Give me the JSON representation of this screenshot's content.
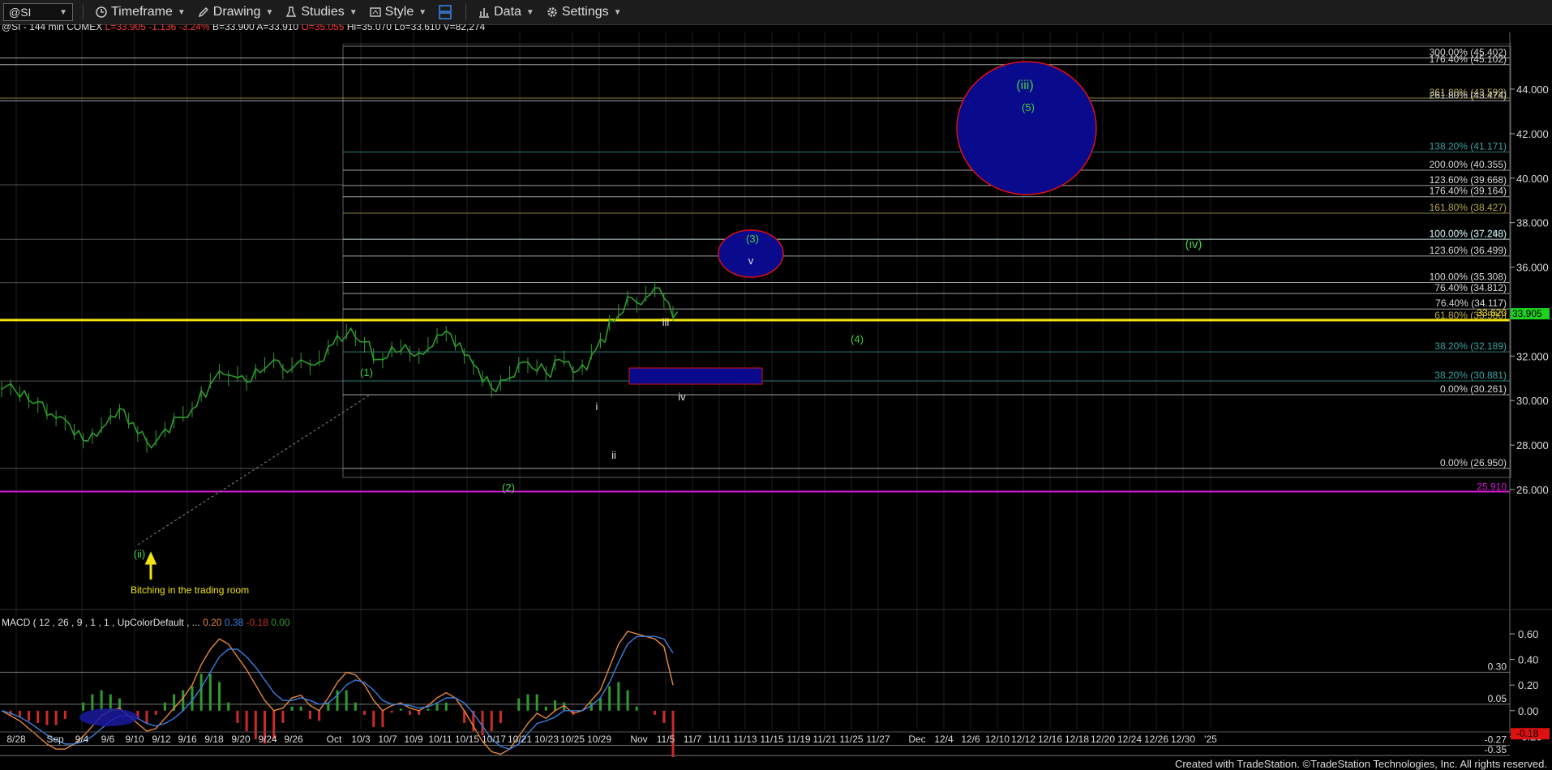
{
  "toolbar": {
    "symbol": "@SI",
    "timeframe": "Timeframe",
    "drawing": "Drawing",
    "studies": "Studies",
    "style": "Style",
    "data": "Data",
    "settings": "Settings"
  },
  "header": {
    "symbol_info": "@SI - 144 min  COMEX",
    "last": "L=33.905",
    "change": "-1.136",
    "pct": "-3.24%",
    "bid": "B=33.900",
    "ask": "A=33.910",
    "open": "O=35.055",
    "high": "Hi=35.070",
    "low": "Lo=33.610",
    "volume": "V=82,274"
  },
  "footer": "Created with TradeStation. ©TradeStation Technologies, Inc. All rights reserved.",
  "colors": {
    "up": "#2f9b2f",
    "down": "#cf2a2a",
    "fib_white": "#d8d8d8",
    "fib_teal": "#3aa3a3",
    "fib_olive": "#b5a84a",
    "yellow": "#f2e30c",
    "magenta": "#d61ad6",
    "wave_green": "#3fd53f",
    "navy": "#0a0a8c",
    "macd_blue": "#3b7de0",
    "macd_orange": "#e8883a"
  },
  "chart_data": {
    "type": "line",
    "title": "@SI - 144 min COMEX",
    "price_axis": {
      "ticks": [
        44,
        42,
        40,
        38,
        36,
        32,
        30,
        28,
        26
      ],
      "tick_labels": [
        "44.000",
        "42.000",
        "40.000",
        "38.000",
        "36.000",
        "32.000",
        "30.000",
        "28.000",
        "26.000"
      ],
      "ylim": [
        25.3,
        45.5
      ]
    },
    "time_axis": {
      "labels": [
        "8/28",
        "Sep",
        "9/4",
        "9/6",
        "9/10",
        "9/12",
        "9/16",
        "9/18",
        "9/20",
        "9/24",
        "9/26",
        "Oct",
        "10/3",
        "10/7",
        "10/9",
        "10/11",
        "10/15",
        "10/17",
        "10/21",
        "10/23",
        "10/25",
        "10/29",
        "Nov",
        "11/5",
        "11/7",
        "11/11",
        "11/13",
        "11/15",
        "11/19",
        "11/21",
        "11/25",
        "11/27",
        "Dec",
        "12/4",
        "12/6",
        "12/10",
        "12/12",
        "12/16",
        "12/18",
        "12/20",
        "12/24",
        "12/26",
        "12/30",
        "'25"
      ],
      "note": "bars labeled in calendar dates"
    },
    "series": [
      {
        "values": [
          30.5,
          30.6,
          30.3,
          30.0,
          29.8,
          29.5,
          29.2,
          29.0,
          28.6,
          28.2,
          28.4,
          28.9,
          29.3,
          29.5,
          29.1,
          28.5,
          28.0,
          28.3,
          28.7,
          29.1,
          29.4,
          29.6,
          30.3,
          30.9,
          31.3,
          31.0,
          31.2,
          30.8,
          31.3,
          31.6,
          31.8,
          31.3,
          31.6,
          31.8,
          31.5,
          31.9,
          32.4,
          32.8,
          33.1,
          32.8,
          32.5,
          32.0,
          31.8,
          32.3,
          32.4,
          32.1,
          32.0,
          32.5,
          32.9,
          33.0,
          32.6,
          32.0,
          31.5,
          31.0,
          30.5,
          30.8,
          31.2,
          31.6,
          31.6,
          31.5,
          31.2,
          31.7,
          31.9,
          31.2,
          31.5,
          32.2,
          32.7,
          33.5,
          34.0,
          34.6,
          34.3,
          34.8,
          35.0,
          34.5,
          33.9
        ]
      }
    ],
    "fib_levels": [
      {
        "label": "300.00% (45.402)",
        "value": 45.402,
        "color": "#d8d8d8"
      },
      {
        "label": "176.40% (45.102)",
        "value": 45.102,
        "color": "#d8d8d8"
      },
      {
        "label": "261.80% (43.599)",
        "value": 43.599,
        "color": "#b5a84a"
      },
      {
        "label": "261.80% (43.474)",
        "value": 43.474,
        "color": "#d8d8d8"
      },
      {
        "label": "138.20% (41.171)",
        "value": 41.171,
        "color": "#3aa3a3"
      },
      {
        "label": "200.00% (40.355)",
        "value": 40.355,
        "color": "#d8d8d8"
      },
      {
        "label": "123.60% (39.668)",
        "value": 39.668,
        "color": "#d8d8d8"
      },
      {
        "label": "176.40% (39.164)",
        "value": 39.164,
        "color": "#d8d8d8"
      },
      {
        "label": "161.80% (38.427)",
        "value": 38.427,
        "color": "#b5a84a"
      },
      {
        "label": "100.00% (37.260)",
        "value": 37.26,
        "color": "#3aa3a3"
      },
      {
        "label": "100.00% (37.248)",
        "value": 37.248,
        "color": "#d8d8d8"
      },
      {
        "label": "123.60% (36.499)",
        "value": 36.499,
        "color": "#d8d8d8"
      },
      {
        "label": "100.00% (35.308)",
        "value": 35.308,
        "color": "#d8d8d8"
      },
      {
        "label": "76.40% (34.812)",
        "value": 34.812,
        "color": "#d8d8d8"
      },
      {
        "label": "76.40% (34.117)",
        "value": 34.117,
        "color": "#d8d8d8"
      },
      {
        "label": "61.80% (33.580)",
        "value": 33.58,
        "color": "#b5a84a"
      },
      {
        "label": "38.20% (32.189)",
        "value": 32.189,
        "color": "#3aa3a3"
      },
      {
        "label": "38.20% (30.881)",
        "value": 30.881,
        "color": "#3aa3a3"
      },
      {
        "label": "0.00% (30.261)",
        "value": 30.261,
        "color": "#d8d8d8"
      },
      {
        "label": "0.00% (26.950)",
        "value": 26.95,
        "color": "#d8d8d8"
      }
    ],
    "marked_prices": [
      {
        "label": "33.620",
        "value": 33.62,
        "color": "#f2e30c"
      },
      {
        "label": "33.905",
        "value": 33.905,
        "color": "#1fd11f"
      },
      {
        "label": "25.910",
        "value": 25.91,
        "color": "#d61ad6"
      }
    ],
    "wave_labels": [
      {
        "text": "(1)",
        "color": "#3fd53f"
      },
      {
        "text": "(2)",
        "color": "#3fd53f"
      },
      {
        "text": "(3)",
        "color": "#3fd53f"
      },
      {
        "text": "(4)",
        "color": "#3fd53f"
      },
      {
        "text": "(5)",
        "color": "#3fd53f"
      },
      {
        "text": "(ii)",
        "color": "#3fd53f"
      },
      {
        "text": "(iii)",
        "color": "#3fd53f"
      },
      {
        "text": "(iv)",
        "color": "#3fd53f"
      },
      {
        "text": "i",
        "color": "#e0e0e0"
      },
      {
        "text": "ii",
        "color": "#e0e0e0"
      },
      {
        "text": "iii",
        "color": "#e0e0e0"
      },
      {
        "text": "iv",
        "color": "#e0e0e0"
      },
      {
        "text": "v",
        "color": "#e0e0e0"
      }
    ],
    "annotation": "Bitching in the trading room",
    "macd": {
      "label": "MACD ( 12 , 26 , 9 , 1 , 1 , UpColorDefault , ...",
      "readouts": [
        "0.20",
        "0.38",
        "-0.18",
        "0.00"
      ],
      "axis_ticks": [
        0.6,
        0.4,
        0.2,
        0.0,
        -0.2
      ],
      "axis_labels": [
        "0.60",
        "0.40",
        "0.20",
        "0.00",
        "-0.20"
      ],
      "levels": [
        {
          "label": "0.30",
          "value": 0.3
        },
        {
          "label": "0.05",
          "value": 0.05
        },
        {
          "label": "-0.27",
          "value": -0.27
        },
        {
          "label": "-0.35",
          "value": -0.35
        }
      ],
      "current": "-0.18",
      "ylim": [
        -0.4,
        0.7
      ],
      "macd": [
        0.0,
        -0.04,
        -0.08,
        -0.14,
        -0.2,
        -0.26,
        -0.3,
        -0.3,
        -0.26,
        -0.2,
        -0.12,
        -0.04,
        0.0,
        0.02,
        -0.04,
        -0.1,
        -0.16,
        -0.14,
        -0.06,
        0.02,
        0.1,
        0.2,
        0.36,
        0.48,
        0.56,
        0.52,
        0.42,
        0.32,
        0.2,
        0.08,
        0.0,
        0.02,
        0.1,
        0.12,
        0.04,
        0.0,
        0.1,
        0.22,
        0.3,
        0.28,
        0.2,
        0.08,
        0.0,
        0.04,
        0.06,
        0.02,
        0.0,
        0.04,
        0.1,
        0.14,
        0.1,
        0.0,
        -0.12,
        -0.24,
        -0.32,
        -0.34,
        -0.3,
        -0.2,
        -0.1,
        -0.02,
        -0.06,
        0.0,
        0.04,
        -0.02,
        0.0,
        0.08,
        0.16,
        0.34,
        0.52,
        0.62,
        0.6,
        0.58,
        0.56,
        0.5,
        0.2
      ],
      "signal": [
        0.0,
        -0.02,
        -0.05,
        -0.09,
        -0.14,
        -0.19,
        -0.23,
        -0.26,
        -0.26,
        -0.24,
        -0.2,
        -0.14,
        -0.08,
        -0.04,
        -0.04,
        -0.06,
        -0.1,
        -0.12,
        -0.1,
        -0.06,
        0.0,
        0.08,
        0.18,
        0.3,
        0.42,
        0.48,
        0.48,
        0.42,
        0.34,
        0.24,
        0.14,
        0.08,
        0.08,
        0.1,
        0.08,
        0.05,
        0.06,
        0.12,
        0.2,
        0.24,
        0.22,
        0.16,
        0.08,
        0.05,
        0.05,
        0.04,
        0.02,
        0.03,
        0.06,
        0.1,
        0.1,
        0.06,
        -0.02,
        -0.12,
        -0.22,
        -0.28,
        -0.3,
        -0.26,
        -0.18,
        -0.1,
        -0.08,
        -0.05,
        0.0,
        0.0,
        0.0,
        0.04,
        0.1,
        0.22,
        0.38,
        0.52,
        0.58,
        0.58,
        0.58,
        0.56,
        0.45
      ]
    }
  }
}
